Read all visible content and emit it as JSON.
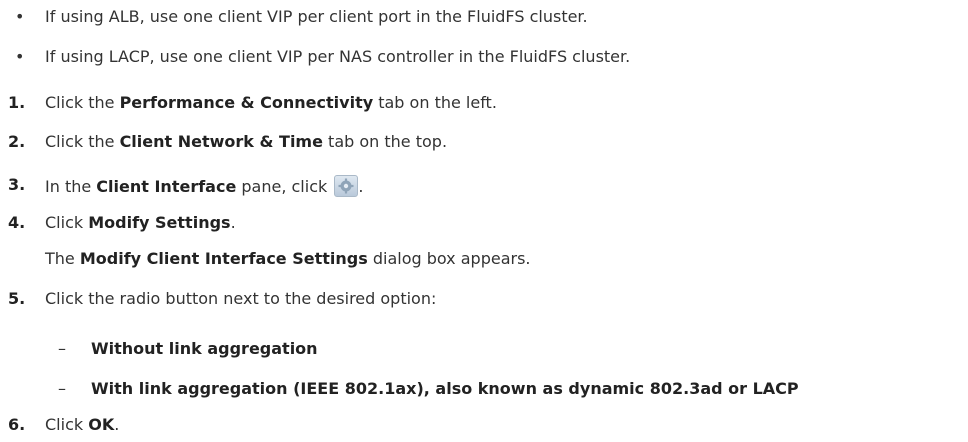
{
  "bullets": [
    {
      "symbol": "•",
      "text": "If using ALB, use one client VIP per client port in the FluidFS cluster."
    },
    {
      "symbol": "•",
      "text": "If using LACP, use one client VIP per NAS controller in the FluidFS cluster."
    }
  ],
  "steps": {
    "s1": {
      "num": "1.",
      "pre": "Click the ",
      "bold": "Performance & Connectivity",
      "post": " tab on the left."
    },
    "s2": {
      "num": "2.",
      "pre": "Click the ",
      "bold": "Client Network & Time",
      "post": " tab on the top."
    },
    "s3": {
      "num": "3.",
      "pre": "In the ",
      "bold": "Client Interface",
      "mid": " pane, click ",
      "post": "."
    },
    "s4": {
      "num": "4.",
      "pre": "Click ",
      "bold": "Modify Settings",
      "post": "."
    },
    "s4b": {
      "pre": "The ",
      "bold": "Modify Client Interface Settings",
      "post": " dialog box appears."
    },
    "s5": {
      "num": "5.",
      "text": "Click the radio button next to the desired option:"
    },
    "s6": {
      "num": "6.",
      "pre": "Click ",
      "bold": "OK",
      "post": "."
    }
  },
  "options": [
    {
      "dash": "–",
      "text": "Without link aggregation"
    },
    {
      "dash": "–",
      "text": "With link aggregation (IEEE 802.1ax), also known as dynamic 802.3ad or LACP"
    }
  ],
  "icons": {
    "settings": "gear-icon"
  }
}
